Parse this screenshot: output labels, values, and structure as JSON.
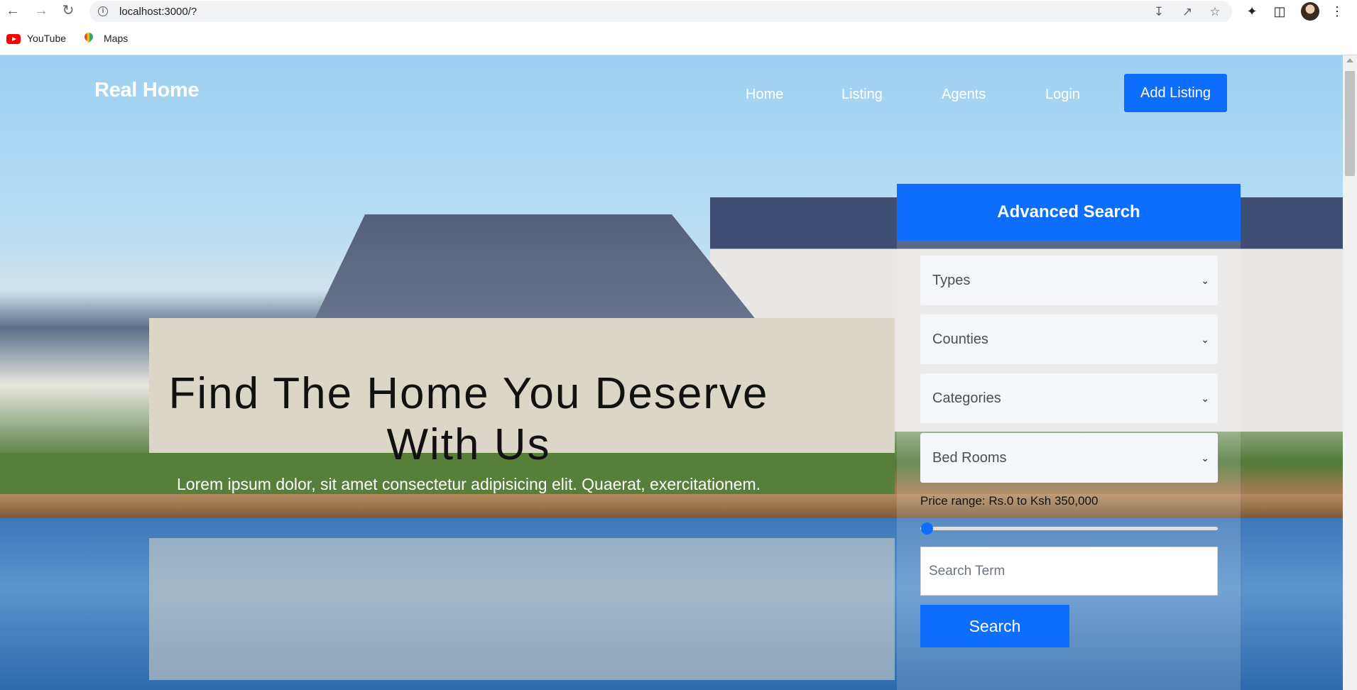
{
  "browser": {
    "url": "localhost:3000/?",
    "bookmarks": [
      {
        "label": "YouTube",
        "icon": "youtube-icon"
      },
      {
        "label": "Maps",
        "icon": "maps-icon"
      }
    ]
  },
  "site": {
    "brand": "Real Home",
    "nav": [
      "Home",
      "Listing",
      "Agents",
      "Login"
    ],
    "cta": "Add Listing"
  },
  "hero": {
    "headline": "Find The Home You Deserve With Us",
    "subline": "Lorem ipsum dolor, sit amet consectetur adipisicing elit. Quaerat, exercitationem."
  },
  "search": {
    "title": "Advanced Search",
    "selects": [
      "Types",
      "Counties",
      "Categories",
      "Bed Rooms"
    ],
    "price_label": "Price range: Rs.0 to Ksh 350,000",
    "price_value_fraction": 0,
    "search_placeholder": "Search Term",
    "button": "Search"
  },
  "colors": {
    "accent": "#0d6efd"
  }
}
